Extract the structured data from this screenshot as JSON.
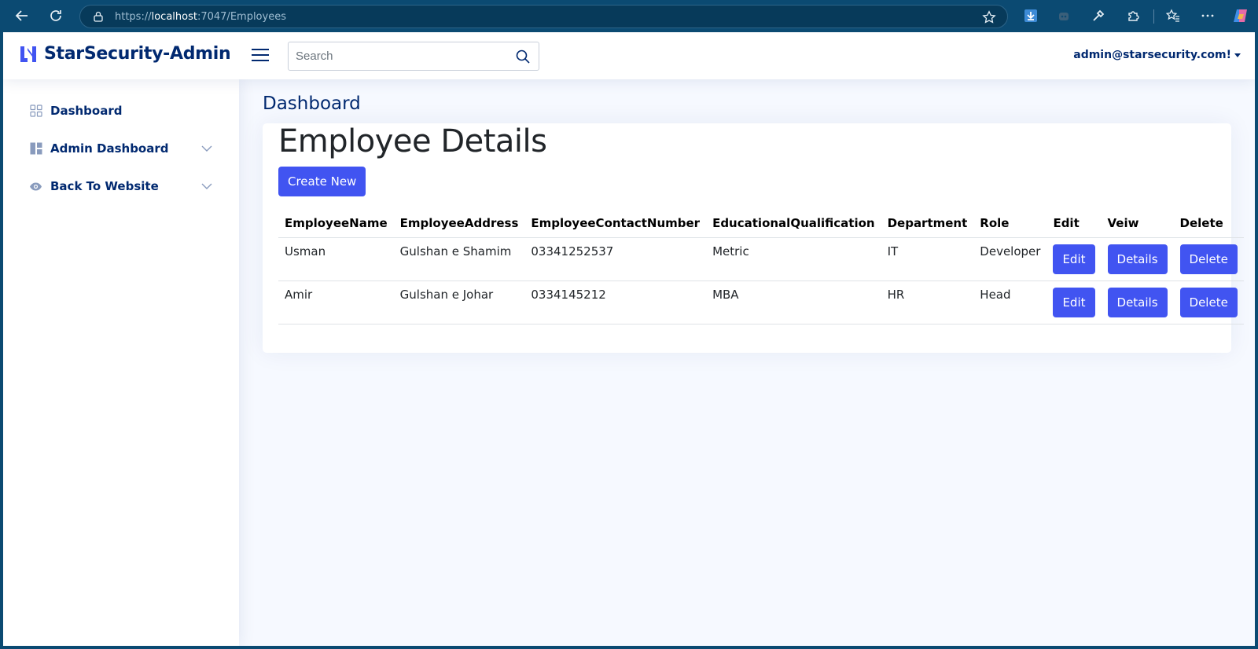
{
  "browser": {
    "url_prefix": "https://",
    "url_host": "localhost",
    "url_rest": ":7047/Employees"
  },
  "header": {
    "logo_text": "StarSecurity-Admin",
    "search_placeholder": "Search",
    "profile_email": "admin@starsecurity.com!"
  },
  "sidebar": {
    "items": [
      {
        "label": "Dashboard",
        "icon": "grid-icon"
      },
      {
        "label": "Admin Dashboard",
        "icon": "layout-icon"
      },
      {
        "label": "Back To Website",
        "icon": "eye-icon"
      }
    ]
  },
  "main": {
    "page_title": "Dashboard",
    "card_title": "Employee Details",
    "create_label": "Create New"
  },
  "table": {
    "headers": [
      "EmployeeName",
      "EmployeeAddress",
      "EmployeeContactNumber",
      "EducationalQualification",
      "Department",
      "Role",
      "Edit",
      "Veiw",
      "Delete"
    ],
    "rows": [
      {
        "name": "Usman",
        "address": "Gulshan e Shamim",
        "contact": "03341252537",
        "qualification": "Metric",
        "department": "IT",
        "role": "Developer",
        "edit": "Edit",
        "details": "Details",
        "delete": "Delete"
      },
      {
        "name": "Amir",
        "address": "Gulshan e Johar",
        "contact": "0334145212",
        "qualification": "MBA",
        "department": "HR",
        "role": "Head",
        "edit": "Edit",
        "details": "Details",
        "delete": "Delete"
      }
    ]
  },
  "colors": {
    "brand": "#012970",
    "primary_button": "#4154f1",
    "page_background": "#f6f9ff",
    "browser_frame": "#0b4a72"
  }
}
